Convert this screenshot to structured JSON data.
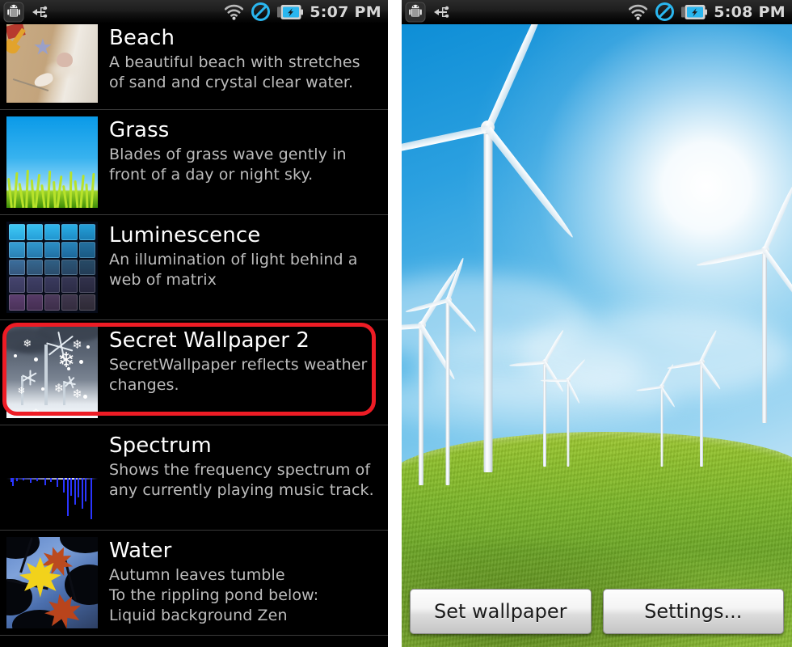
{
  "left_screen": {
    "statusbar": {
      "icons_left": [
        "android-debug-icon",
        "usb-icon"
      ],
      "icons_right": [
        "wifi-icon",
        "no-sim-icon",
        "battery-charging-icon"
      ],
      "clock": "5:07 PM"
    },
    "wallpaper_list": {
      "items": [
        {
          "name": "Beach",
          "description": "A beautiful beach with stretches of sand and crystal clear water.",
          "thumbnail": "beach-thumbnail",
          "selected": false
        },
        {
          "name": "Grass",
          "description": "Blades of grass wave gently in front of a day or night sky.",
          "thumbnail": "grass-thumbnail",
          "selected": false
        },
        {
          "name": "Luminescence",
          "description": "An illumination of light behind a web of matrix",
          "thumbnail": "luminescence-thumbnail",
          "selected": false
        },
        {
          "name": "Secret Wallpaper 2",
          "description": "SecretWallpaper reflects weather changes.",
          "thumbnail": "secret-wallpaper-2-thumbnail",
          "selected": true
        },
        {
          "name": "Spectrum",
          "description": "Shows the frequency spectrum of any currently playing music track.",
          "thumbnail": "spectrum-thumbnail",
          "selected": false
        },
        {
          "name": "Water",
          "description": "Autumn leaves tumble\nTo the rippling pond below:\nLiquid background Zen",
          "thumbnail": "water-thumbnail",
          "selected": false
        }
      ],
      "highlight_color": "#ee1c25"
    }
  },
  "right_screen": {
    "statusbar": {
      "icons_left": [
        "android-debug-icon",
        "usb-icon"
      ],
      "icons_right": [
        "wifi-icon",
        "no-sim-icon",
        "battery-charging-icon"
      ],
      "clock": "5:08 PM"
    },
    "preview": {
      "scene": "wind-turbines-sunny-field",
      "sky_color": "#2ba0e0",
      "grass_color": "#7cb62a"
    },
    "buttons": {
      "set_wallpaper": "Set wallpaper",
      "settings": "Settings..."
    }
  }
}
